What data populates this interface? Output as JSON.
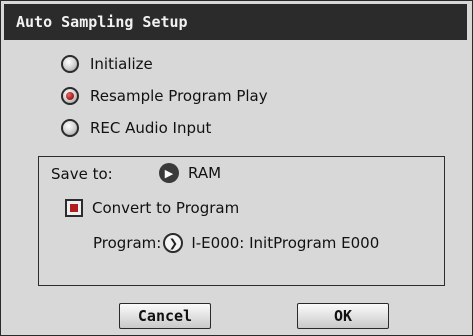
{
  "dialog": {
    "title": "Auto Sampling Setup"
  },
  "options": [
    {
      "label": "Initialize",
      "selected": false
    },
    {
      "label": "Resample Program Play",
      "selected": true
    },
    {
      "label": "REC Audio Input",
      "selected": false
    }
  ],
  "save_to": {
    "label": "Save to:",
    "value": "RAM"
  },
  "convert": {
    "label": "Convert to Program",
    "checked": true
  },
  "program": {
    "label": "Program:",
    "value": "I-E000: InitProgram E000"
  },
  "buttons": {
    "cancel": "Cancel",
    "ok": "OK"
  },
  "icons": {
    "dropdown": "triangle-right-icon",
    "popup": "chevron-right-icon"
  },
  "colors": {
    "title_bg": "#2b2b2b",
    "accent": "#b01e1e",
    "panel": "#d8d8d8"
  }
}
